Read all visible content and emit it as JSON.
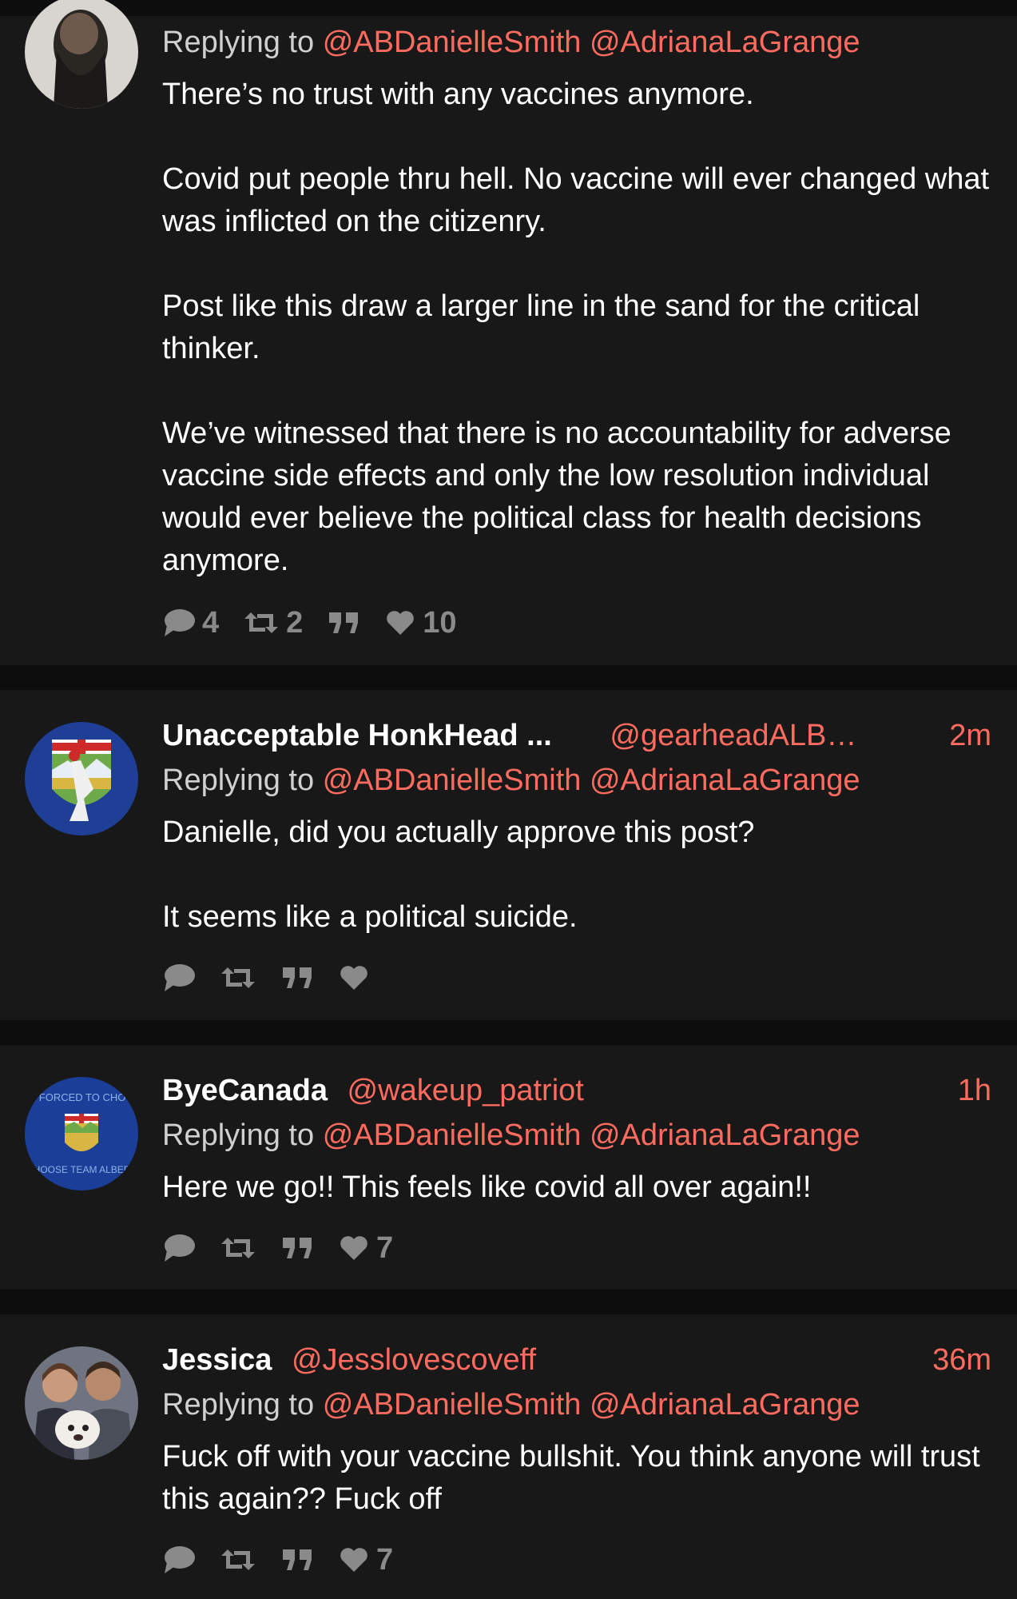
{
  "colors": {
    "background": "#0d0d0d",
    "card": "#181818",
    "accent": "#ff6b5f",
    "text": "#ffffff",
    "muted": "#8a8a8a"
  },
  "tweets": [
    {
      "name": "",
      "handle": "",
      "time": "",
      "replying_prefix": "Replying to",
      "mentions": [
        "@ABDanielleSmith",
        "@AdrianaLaGrange"
      ],
      "paragraphs": [
        "There’s no trust with any vaccines anymore.",
        "Covid put people thru hell. No vaccine will ever changed what was inflicted on the citizenry.",
        "Post like this draw a larger line in the sand for the critical thinker.",
        "We’ve witnessed that there is no accountability for adverse vaccine side effects and only the low resolution individual would ever believe the political class for health decisions anymore."
      ],
      "replies": "4",
      "retweets": "2",
      "likes": "10"
    },
    {
      "name": "Unacceptable HonkHead ...",
      "handle": "@gearheadALB…",
      "time": "2m",
      "replying_prefix": "Replying to",
      "mentions": [
        "@ABDanielleSmith",
        "@AdrianaLaGrange"
      ],
      "paragraphs": [
        "Danielle, did you actually approve this post?",
        "It seems like a political suicide."
      ],
      "replies": "",
      "retweets": "",
      "likes": ""
    },
    {
      "name": "ByeCanada",
      "handle": "@wakeup_patriot",
      "time": "1h",
      "replying_prefix": "Replying to",
      "mentions": [
        "@ABDanielleSmith",
        "@AdrianaLaGrange"
      ],
      "paragraphs": [
        "Here we go!! This feels like covid all over again!!"
      ],
      "replies": "",
      "retweets": "",
      "likes": "7",
      "avatar_text_top": "I AM FORCED TO CHOOSE",
      "avatar_text_bottom": "I CHOOSE TEAM ALBERTA"
    },
    {
      "name": "Jessica",
      "handle": "@Jesslovescoveff",
      "time": "36m",
      "replying_prefix": "Replying to",
      "mentions": [
        "@ABDanielleSmith",
        "@AdrianaLaGrange"
      ],
      "paragraphs": [
        "Fuck off with your vaccine bullshit. You think anyone will trust this again?? Fuck off"
      ],
      "replies": "",
      "retweets": "",
      "likes": "7"
    }
  ],
  "icons": {
    "reply": "speech-bubble-icon",
    "retweet": "retweet-icon",
    "quote": "quote-icon",
    "like": "heart-icon"
  }
}
